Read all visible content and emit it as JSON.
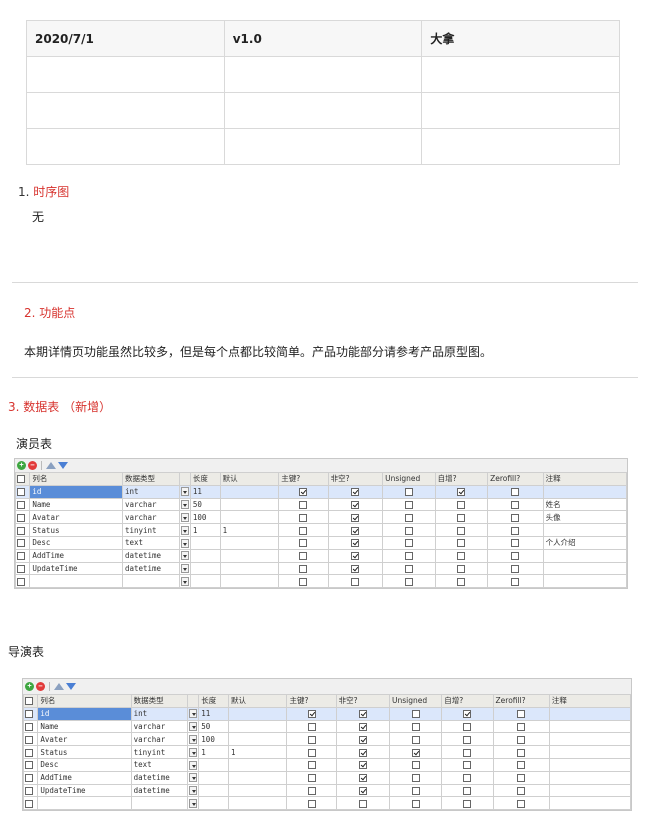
{
  "version_table": {
    "rows": [
      [
        "2020/7/1",
        "v1.0",
        "大拿"
      ],
      [
        "",
        "",
        ""
      ],
      [
        "",
        "",
        ""
      ],
      [
        "",
        "",
        ""
      ]
    ]
  },
  "sections": {
    "s1_num": "1.",
    "s1_title": "时序图",
    "s1_body": "无",
    "s2_title": "2. 功能点",
    "s2_body": "本期详情页功能虽然比较多，但是每个点都比较简单。产品功能部分请参考产品原型图。",
    "s3_title": "3. 数据表 （新增）"
  },
  "tables": {
    "actor_label": "演员表",
    "director_label": "导演表",
    "columns": [
      "列名",
      "数据类型",
      "长度",
      "默认",
      "主键?",
      "非空?",
      "Unsigned",
      "自增?",
      "Zerofill?",
      "注释"
    ],
    "actor_rows": [
      {
        "name": "id",
        "type": "int",
        "len": "11",
        "def": "",
        "pk": true,
        "nn": true,
        "un": false,
        "ai": true,
        "zf": false,
        "comment": ""
      },
      {
        "name": "Name",
        "type": "varchar",
        "len": "50",
        "def": "",
        "pk": false,
        "nn": true,
        "un": false,
        "ai": false,
        "zf": false,
        "comment": "姓名"
      },
      {
        "name": "Avatar",
        "type": "varchar",
        "len": "100",
        "def": "",
        "pk": false,
        "nn": true,
        "un": false,
        "ai": false,
        "zf": false,
        "comment": "头像"
      },
      {
        "name": "Status",
        "type": "tinyint",
        "len": "1",
        "def": "1",
        "pk": false,
        "nn": true,
        "un": false,
        "ai": false,
        "zf": false,
        "comment": ""
      },
      {
        "name": "Desc",
        "type": "text",
        "len": "",
        "def": "",
        "pk": false,
        "nn": true,
        "un": false,
        "ai": false,
        "zf": false,
        "comment": "个人介绍"
      },
      {
        "name": "AddTime",
        "type": "datetime",
        "len": "",
        "def": "",
        "pk": false,
        "nn": true,
        "un": false,
        "ai": false,
        "zf": false,
        "comment": ""
      },
      {
        "name": "UpdateTime",
        "type": "datetime",
        "len": "",
        "def": "",
        "pk": false,
        "nn": true,
        "un": false,
        "ai": false,
        "zf": false,
        "comment": ""
      },
      {
        "name": "",
        "type": "",
        "len": "",
        "def": "",
        "pk": false,
        "nn": false,
        "un": false,
        "ai": false,
        "zf": false,
        "comment": ""
      }
    ],
    "director_rows": [
      {
        "name": "id",
        "type": "int",
        "len": "11",
        "def": "",
        "pk": true,
        "nn": true,
        "un": false,
        "ai": true,
        "zf": false,
        "comment": ""
      },
      {
        "name": "Name",
        "type": "varchar",
        "len": "50",
        "def": "",
        "pk": false,
        "nn": true,
        "un": false,
        "ai": false,
        "zf": false,
        "comment": ""
      },
      {
        "name": "Avater",
        "type": "varchar",
        "len": "100",
        "def": "",
        "pk": false,
        "nn": true,
        "un": false,
        "ai": false,
        "zf": false,
        "comment": ""
      },
      {
        "name": "Status",
        "type": "tinyint",
        "len": "1",
        "def": "1",
        "pk": false,
        "nn": true,
        "un": true,
        "ai": false,
        "zf": false,
        "comment": ""
      },
      {
        "name": "Desc",
        "type": "text",
        "len": "",
        "def": "",
        "pk": false,
        "nn": true,
        "un": false,
        "ai": false,
        "zf": false,
        "comment": ""
      },
      {
        "name": "AddTime",
        "type": "datetime",
        "len": "",
        "def": "",
        "pk": false,
        "nn": true,
        "un": false,
        "ai": false,
        "zf": false,
        "comment": ""
      },
      {
        "name": "UpdateTime",
        "type": "datetime",
        "len": "",
        "def": "",
        "pk": false,
        "nn": true,
        "un": false,
        "ai": false,
        "zf": false,
        "comment": ""
      },
      {
        "name": "",
        "type": "",
        "len": "",
        "def": "",
        "pk": false,
        "nn": false,
        "un": false,
        "ai": false,
        "zf": false,
        "comment": ""
      }
    ]
  }
}
